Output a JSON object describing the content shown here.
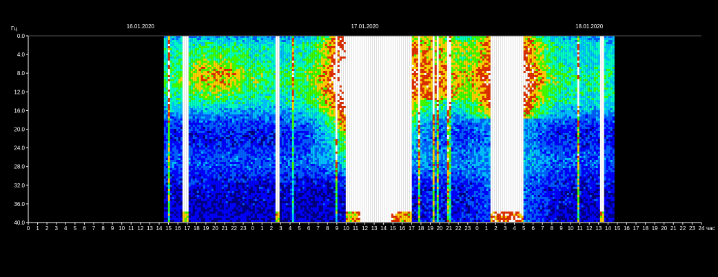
{
  "chart_data": {
    "type": "heatmap",
    "title": "",
    "ylabel": "Гц",
    "xlabel": "час",
    "ylim": [
      40.0,
      0.0
    ],
    "y_ticks": [
      "0.0",
      "4.0",
      "8.0",
      "12.0",
      "16.0",
      "20.0",
      "24.0",
      "28.0",
      "32.0",
      "36.0",
      "40.0"
    ],
    "x_ticks": [
      "0",
      "1",
      "2",
      "3",
      "4",
      "5",
      "6",
      "7",
      "8",
      "9",
      "10",
      "11",
      "12",
      "13",
      "14",
      "15",
      "16",
      "17",
      "18",
      "19",
      "20",
      "21",
      "22",
      "23",
      "0",
      "1",
      "2",
      "3",
      "4",
      "5",
      "6",
      "7",
      "8",
      "9",
      "10",
      "11",
      "12",
      "13",
      "14",
      "15",
      "16",
      "17",
      "18",
      "19",
      "20",
      "21",
      "22",
      "23",
      "0",
      "1",
      "2",
      "3",
      "4",
      "5",
      "6",
      "7",
      "8",
      "9",
      "10",
      "11",
      "12",
      "13",
      "14",
      "15",
      "16",
      "17",
      "18",
      "19",
      "20",
      "21",
      "22",
      "23",
      "24"
    ],
    "dates": [
      {
        "label": "16.01.2020",
        "hour": 12
      },
      {
        "label": "17.01.2020",
        "hour": 36
      },
      {
        "label": "18.01.2020",
        "hour": 60
      }
    ],
    "xlim": [
      0,
      72
    ],
    "data_range_hours": [
      14.5,
      62.8
    ],
    "colorscale": [
      "#000080",
      "#0000ff",
      "#0060ff",
      "#00c0ff",
      "#00ffc0",
      "#40ff00",
      "#ffd000",
      "#e03000",
      "#ffffff"
    ],
    "saturated_periods_hours": [
      [
        16.6,
        17.1
      ],
      [
        26.5,
        27.0
      ],
      [
        34.0,
        37.5
      ],
      [
        37.0,
        41.0
      ],
      [
        49.5,
        53.0
      ],
      [
        61.2,
        61.8
      ]
    ],
    "grid": false,
    "legend": "none"
  }
}
